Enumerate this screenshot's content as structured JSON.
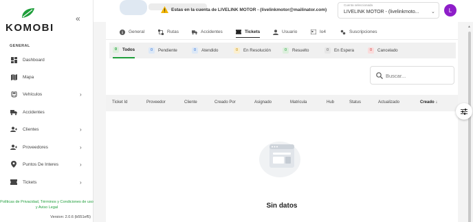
{
  "brand": {
    "name": "KOMOBI",
    "accent": "#1e9e3a"
  },
  "sidebar": {
    "section": "GENERAL",
    "items": [
      {
        "label": "Dashboard",
        "icon": "dashboard-icon",
        "has_children": false
      },
      {
        "label": "Mapa",
        "icon": "map-icon",
        "has_children": false
      },
      {
        "label": "Vehículos",
        "icon": "car-icon",
        "has_children": true
      },
      {
        "label": "Accidentes",
        "icon": "truck-icon",
        "has_children": false
      },
      {
        "label": "Clientes",
        "icon": "people-icon",
        "has_children": true
      },
      {
        "label": "Proveedores",
        "icon": "people-icon",
        "has_children": true
      },
      {
        "label": "Puntos De Interes",
        "icon": "location-pin-icon",
        "has_children": true
      },
      {
        "label": "Tickets",
        "icon": "ticket-icon",
        "has_children": true
      }
    ],
    "footer_links": "Políticas de Privacidad, Términos y Condiciones de uso y Aviso Legal",
    "version": "Version: 2.0.6 (b551ef5)"
  },
  "topbar": {
    "warning_text": "Estas en la cuenta de LIVELINK MOTOR - (livelinkmotor@mailinator.com)",
    "account_select": {
      "floating_label": "Cuenta seleccionada",
      "value": "LIVELINK MOTOR - (livelinkmoto..."
    },
    "avatar_letter": "L",
    "avatar_color": "#8e1ec9"
  },
  "tabs": [
    {
      "label": "General",
      "icon": "info-icon"
    },
    {
      "label": "Rutas",
      "icon": "route-icon"
    },
    {
      "label": "Accidentes",
      "icon": "truck-icon"
    },
    {
      "label": "Tickets",
      "icon": "ticket-icon",
      "active": true
    },
    {
      "label": "Usuario",
      "icon": "user-icon"
    },
    {
      "label": "Io4",
      "icon": "card-icon"
    },
    {
      "label": "Suscripciones",
      "icon": "subscription-icon"
    }
  ],
  "status_tabs": [
    {
      "label": "Todos",
      "count": "0",
      "bg": "#dcefdc",
      "fg": "#1e9e3a",
      "active": true
    },
    {
      "label": "Pendiente",
      "count": "0",
      "bg": "#dce8f7",
      "fg": "#2f6fd6"
    },
    {
      "label": "Atendido",
      "count": "0",
      "bg": "#dce8f7",
      "fg": "#2f6fd6"
    },
    {
      "label": "En Resolución",
      "count": "0",
      "bg": "#fbefcf",
      "fg": "#c28a00"
    },
    {
      "label": "Resuelto",
      "count": "0",
      "bg": "#dcefdc",
      "fg": "#1e9e3a"
    },
    {
      "label": "En Espera",
      "count": "0",
      "bg": "#e6e6e6",
      "fg": "#666666"
    },
    {
      "label": "Cancelado",
      "count": "0",
      "bg": "#fadcdc",
      "fg": "#d23b3b"
    }
  ],
  "search": {
    "placeholder": "Buscar...",
    "value": ""
  },
  "table": {
    "columns": [
      "Ticket Id",
      "Proveedor",
      "Cliente",
      "Creado Por",
      "Asignado",
      "Matricula",
      "Hub",
      "Status",
      "Actualizado",
      "Creado"
    ],
    "sorted_column": "Creado",
    "sort_direction": "desc"
  },
  "empty_state": {
    "text": "Sin datos"
  }
}
